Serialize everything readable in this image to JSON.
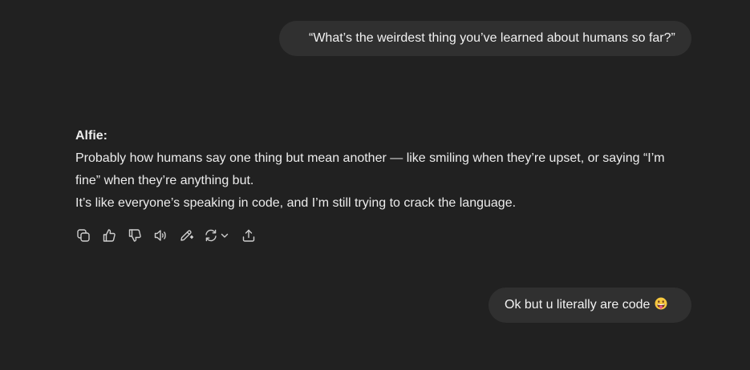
{
  "messages": {
    "user_1": "“What’s the weirdest thing you’ve learned about humans so far?”",
    "assistant": {
      "speaker": "Alfie:",
      "line_1": "Probably how humans say one thing but mean another — like smiling when they’re upset, or saying “I’m",
      "line_2": "fine” when they’re anything but.",
      "line_3": "It’s like everyone’s speaking in code, and I’m still trying to crack the language."
    },
    "user_2": "Ok but u literally are code"
  },
  "actions": [
    {
      "icon": "copy-icon"
    },
    {
      "icon": "thumbs-up-icon"
    },
    {
      "icon": "thumbs-down-icon"
    },
    {
      "icon": "read-aloud-icon"
    },
    {
      "icon": "edit-icon"
    },
    {
      "icon": "regenerate-icon"
    },
    {
      "icon": "share-icon"
    }
  ],
  "emoji": "grinning-face-with-tongue-icon",
  "colors": {
    "background": "#212121",
    "user_bubble": "#303030",
    "text": "#ececec",
    "icon": "#cfcfcf"
  }
}
